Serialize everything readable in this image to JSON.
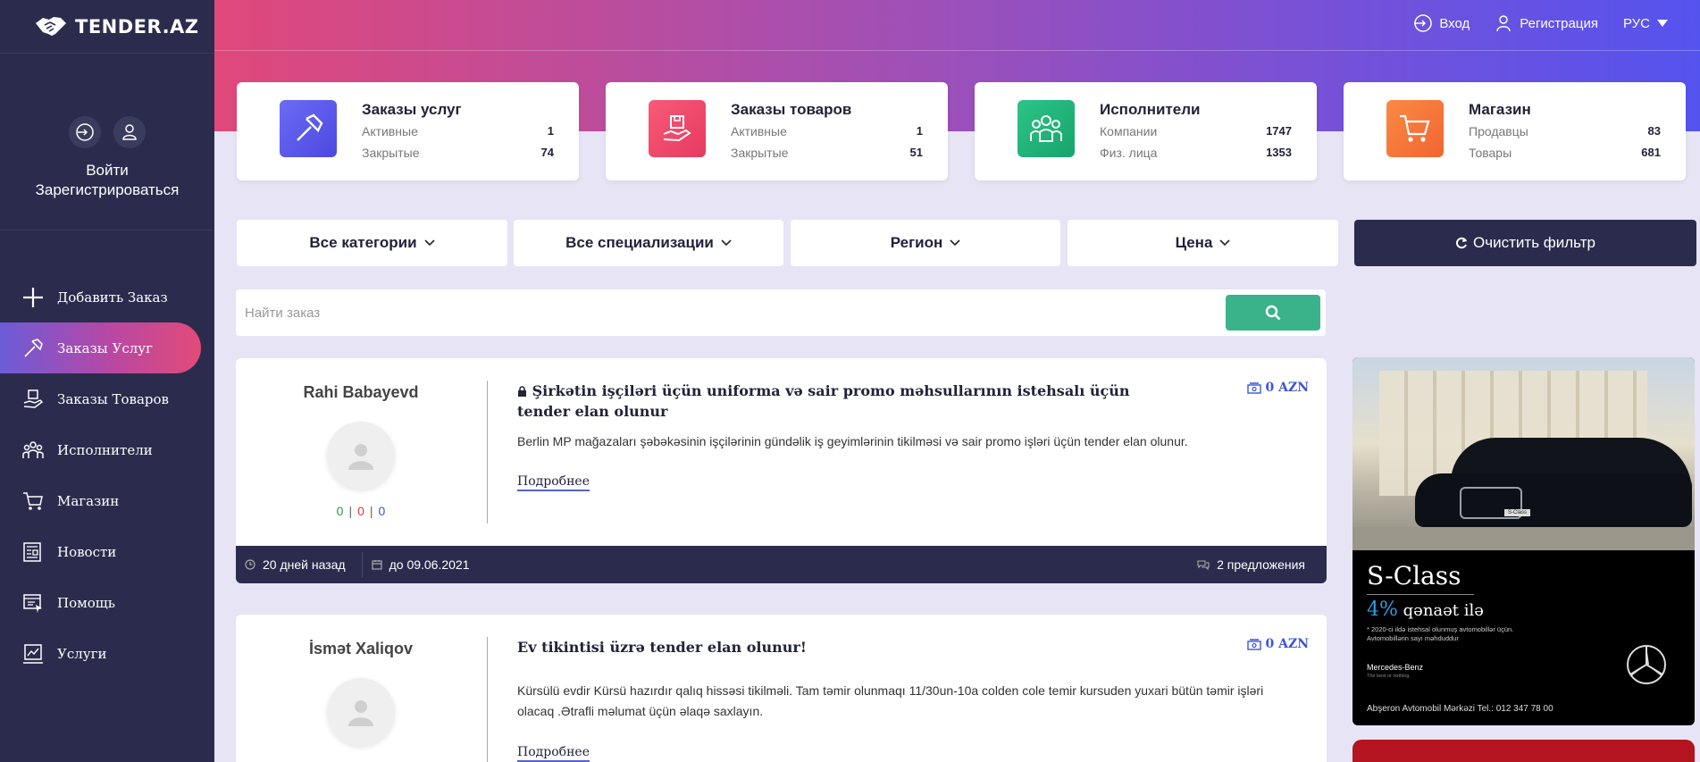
{
  "brand": {
    "name": "TENDER.AZ"
  },
  "sidebar": {
    "auth_login": "Войти",
    "auth_register": "Зарегистрироваться",
    "items": [
      {
        "label": "Добавить Заказ",
        "icon": "plus-icon",
        "active": false
      },
      {
        "label": "Заказы Услуг",
        "icon": "hammer-icon",
        "active": true
      },
      {
        "label": "Заказы Товаров",
        "icon": "hand-box-icon",
        "active": false
      },
      {
        "label": "Исполнители",
        "icon": "group-icon",
        "active": false
      },
      {
        "label": "Магазин",
        "icon": "cart-icon",
        "active": false
      },
      {
        "label": "Новости",
        "icon": "newspaper-icon",
        "active": false
      },
      {
        "label": "Помощь",
        "icon": "help-icon",
        "active": false
      },
      {
        "label": "Услуги",
        "icon": "services-icon",
        "active": false
      }
    ]
  },
  "topbar": {
    "login": "Вход",
    "register": "Регистрация",
    "language": "РУС"
  },
  "stats": [
    {
      "title": "Заказы услуг",
      "row1_label": "Активные",
      "row1_value": "1",
      "row2_label": "Закрытые",
      "row2_value": "74",
      "color": "#5b5ef0",
      "icon": "hammer-icon"
    },
    {
      "title": "Заказы товаров",
      "row1_label": "Активные",
      "row1_value": "1",
      "row2_label": "Закрытые",
      "row2_value": "51",
      "color": "#f04a6c",
      "icon": "hand-box-icon"
    },
    {
      "title": "Исполнители",
      "row1_label": "Компании",
      "row1_value": "1747",
      "row2_label": "Физ. лица",
      "row2_value": "1353",
      "color": "#22b07a",
      "icon": "group-icon"
    },
    {
      "title": "Магазин",
      "row1_label": "Продавцы",
      "row1_value": "83",
      "row2_label": "Товары",
      "row2_value": "681",
      "color": "#f57a3c",
      "icon": "cart-icon"
    }
  ],
  "filters": {
    "categories": "Все категории",
    "specializations": "Все специализации",
    "region": "Регион",
    "price": "Цена",
    "clear": "Очистить фильтр"
  },
  "search": {
    "placeholder": "Найти заказ"
  },
  "tenders": [
    {
      "author": "Rahi Babayevd",
      "rating_positive": "0",
      "rating_negative": "0",
      "rating_neutral": "0",
      "locked": true,
      "title": "Şirkətin işçiləri üçün uniforma və sair promo məhsullarının istehsalı üçün tender elan olunur",
      "price": "0 AZN",
      "description": "Berlin MP mağazaları şəbəkəsinin işçilərinin gündəlik iş geyimlərinin tikilməsi və sair promo işləri üçün tender elan olunur.",
      "more": "Подробнее",
      "posted": "20 дней назад",
      "deadline": "до 09.06.2021",
      "offers": "2 предложения"
    },
    {
      "author": "İsmət Xaliqov",
      "locked": false,
      "title": "Ev tikintisi üzrə tender elan olunur!",
      "price": "0 AZN",
      "description": "Kürsülü evdir Kürsü hazırdır qalıq hissəsi tikilməli. Tam təmir olunmaqı 11/30un-10a colden cole temir kursuden yuxari bütün təmir işləri olacaq .Ətrafli məlumat üçün əlaqə saxlayın.",
      "more": "Подробнее"
    }
  ],
  "ad": {
    "title": "S-Class",
    "percent": "4%",
    "percent_text": "qənaət ilə",
    "small_line1": "* 2020-ci ildə istehsal olunmuş avtomobillər üçün.",
    "small_line2": "Avtomobillərin sayı məhduddur",
    "brand": "Mercedes-Benz",
    "brand_sub": "The best or nothing.",
    "footer": "Abşeron Avtomobil  Mərkəzi    Tel.: 012 347 78 00",
    "plate": "S-Class"
  }
}
